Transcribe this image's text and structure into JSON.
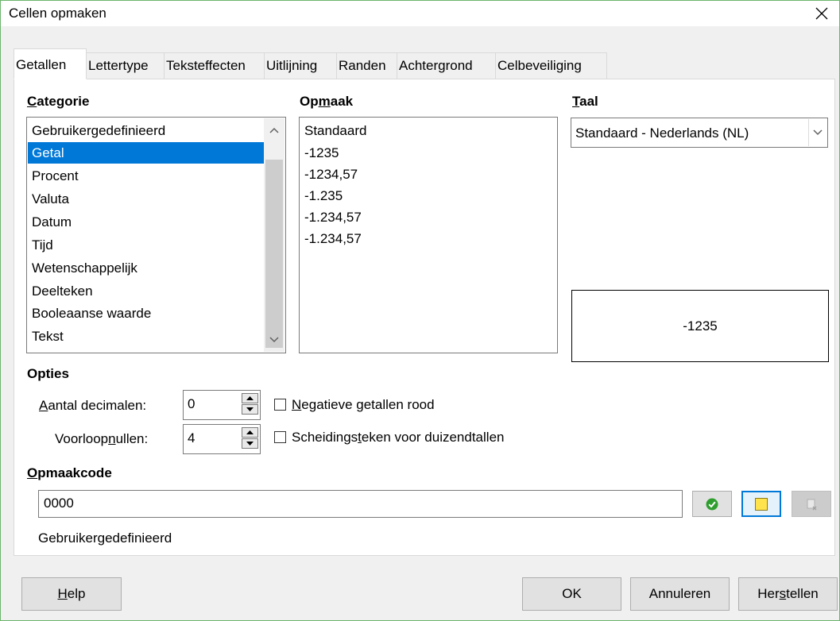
{
  "window": {
    "title": "Cellen opmaken",
    "close_glyph": "✕"
  },
  "tabs": [
    {
      "label": "Getallen"
    },
    {
      "label": "Lettertype"
    },
    {
      "label": "Teksteffecten"
    },
    {
      "label": "Uitlijning"
    },
    {
      "label": "Randen"
    },
    {
      "label": "Achtergrond"
    },
    {
      "label": "Celbeveiliging"
    }
  ],
  "category": {
    "heading_pre": "",
    "heading_u": "C",
    "heading_post": "ategorie",
    "items": [
      "Gebruikergedefinieerd",
      "Getal",
      "Procent",
      "Valuta",
      "Datum",
      "Tijd",
      "Wetenschappelijk",
      "Deelteken",
      "Booleaanse waarde",
      "Tekst"
    ],
    "selected": "Getal"
  },
  "format": {
    "heading_pre": "Op",
    "heading_u": "m",
    "heading_post": "aak",
    "items": [
      "Standaard",
      "-1235",
      "-1234,57",
      "-1.235",
      "-1.234,57",
      "-1.234,57"
    ]
  },
  "language": {
    "heading_pre": "",
    "heading_u": "T",
    "heading_post": "aal",
    "value": "Standaard - Nederlands (NL)"
  },
  "preview": {
    "value": "-1235"
  },
  "options": {
    "heading": "Opties",
    "decimals_label_pre": "",
    "decimals_label_u": "A",
    "decimals_label_post": "antal decimalen:",
    "decimals_value": "0",
    "leading_label_pre": "Voorloop",
    "leading_label_u": "n",
    "leading_label_post": "ullen:",
    "leading_value": "4",
    "negative_red_pre": "",
    "negative_red_u": "N",
    "negative_red_post": "egatieve getallen rood",
    "negative_red_checked": false,
    "thousands_pre": "Scheidings",
    "thousands_u": "t",
    "thousands_post": "eken voor duizendtallen",
    "thousands_checked": false
  },
  "format_code": {
    "heading_pre": "",
    "heading_u": "O",
    "heading_post": "pmaakcode",
    "value": "0000",
    "description": "Gebruikergedefinieerd"
  },
  "buttons": {
    "help_u": "H",
    "help_post": "elp",
    "ok": "OK",
    "cancel": "Annuleren",
    "reset_pre": "Her",
    "reset_u": "s",
    "reset_post": "tellen"
  },
  "colors": {
    "accent": "#0078d7",
    "check_green": "#2e9e2e",
    "note_yellow": "#ffe34d"
  }
}
